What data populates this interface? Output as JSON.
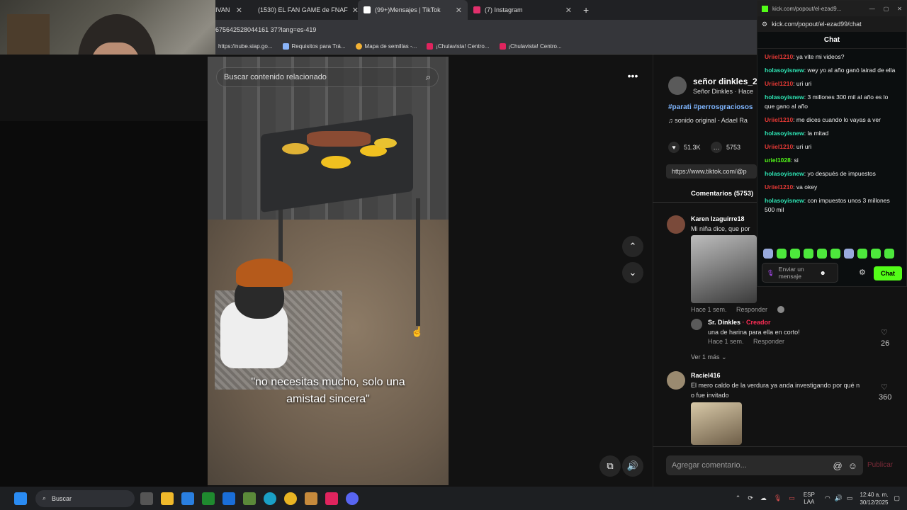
{
  "tabs": [
    {
      "label": "IVAN",
      "active": false
    },
    {
      "label": "(1530) EL FAN GAME de FNAF",
      "active": false,
      "icon_color": "#ff0000"
    },
    {
      "label": "(99+)Mensajes | TikTok",
      "active": true,
      "icon_color": "#ffffff"
    },
    {
      "label": "(7) Instagram",
      "active": false,
      "icon_color": "#e1306c"
    }
  ],
  "new_tab": "+",
  "url": "675642528044161 37?lang=es-419",
  "bookmarks": [
    {
      "label": "https://nube.siap.go...",
      "icon_color": "#4a90e2"
    },
    {
      "label": "Requisitos para Trá...",
      "icon_color": "#8ab4f8"
    },
    {
      "label": "Mapa de semillas -...",
      "icon_color": "#f2b134"
    },
    {
      "label": "¡Chulavista! Centro...",
      "icon_color": "#e0245e"
    },
    {
      "label": "¡Chulavista! Centro...",
      "icon_color": "#e0245e"
    }
  ],
  "video": {
    "search_placeholder": "Buscar contenido relacionado",
    "caption_line1": "\"no necesitas mucho, solo una",
    "caption_line2": "amistad sincera\""
  },
  "post": {
    "author": "señor dinkles_2",
    "subline": "Señor Dinkles · Hace",
    "tags": "#parati #perrosgraciosos",
    "sound": "sonido original - Adael Ra",
    "likes": "51.3K",
    "comments_count": "5753",
    "link": "https://www.tiktok.com/@p",
    "comments_tab": "Comentarios (5753)"
  },
  "comments": [
    {
      "user": "Karen Izaguirre18",
      "text": "Mi niña dice, que por",
      "meta": "Hace 1 sem.",
      "reply": "Responder"
    },
    {
      "user": "Sr. Dinkles",
      "creator": "· Creador",
      "text": "una de harina para ella en corto!",
      "meta": "Hace 1 sem.",
      "reply": "Responder",
      "likes": "26"
    },
    {
      "more": "Ver 1 más"
    },
    {
      "user": "Raciel416",
      "text": "El mero caldo de la verdura ya anda investigando por qué n",
      "text2": "o fue invitado",
      "likes": "360"
    }
  ],
  "add_comment": {
    "placeholder": "Agregar comentario...",
    "at": "@",
    "publish": "Publicar"
  },
  "kick": {
    "title_url": "kick.com/popout/el-ezad9...",
    "address": "kick.com/popout/el-ezad99/chat",
    "heading": "Chat",
    "messages": [
      {
        "user": "Uriiel1210",
        "color": "#e53935",
        "text": "ya vite mi videos?"
      },
      {
        "user": "holasoyisnew",
        "color": "#2ee6b5",
        "text": "wey yo al año ganó lairad de ella"
      },
      {
        "user": "Uriiel1210",
        "color": "#e53935",
        "text": "uri uri"
      },
      {
        "user": "holasoyisnew",
        "color": "#2ee6b5",
        "text": "3 millones 300 mil al año es lo que gano al año"
      },
      {
        "user": "Uriiel1210",
        "color": "#e53935",
        "text": "me dices cuando lo vayas a ver"
      },
      {
        "user": "holasoyisnew",
        "color": "#2ee6b5",
        "text": "la mitad"
      },
      {
        "user": "Uriiel1210",
        "color": "#e53935",
        "text": "uri uri"
      },
      {
        "user": "uriel1028",
        "color": "#53fc18",
        "text": "si"
      },
      {
        "user": "holasoyisnew",
        "color": "#2ee6b5",
        "text": "yo después de impuestos"
      },
      {
        "user": "Uriiel1210",
        "color": "#e53935",
        "text": "va okey"
      },
      {
        "user": "holasoyisnew",
        "color": "#2ee6b5",
        "text": "con impuestos unos 3 millones 500 mil"
      }
    ],
    "input_placeholder": "Enviar un mensaje",
    "send": "Chat"
  },
  "taskbar": {
    "search": "Buscar",
    "lang1": "ESP",
    "lang2": "LAA",
    "time": "12:40 a. m.",
    "date": "30/12/2025"
  }
}
